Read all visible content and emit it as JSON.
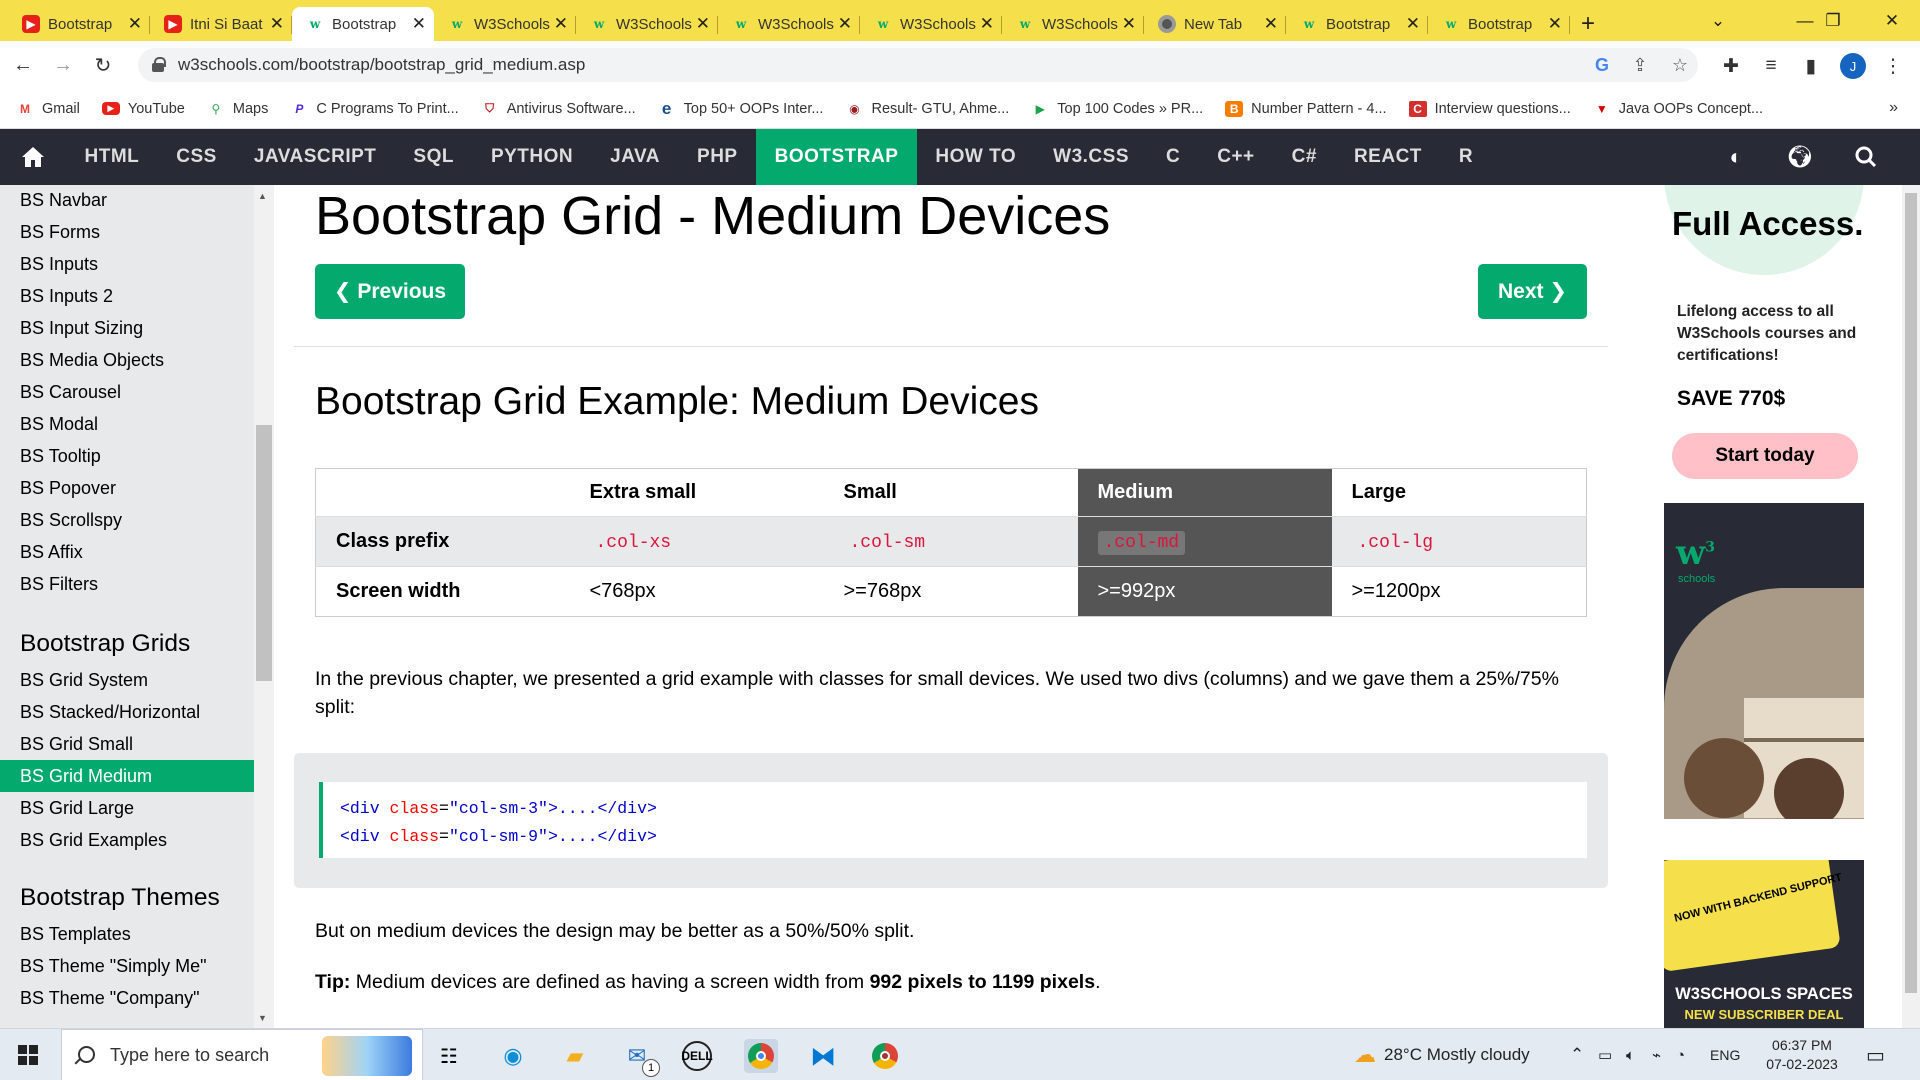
{
  "browser": {
    "tabs": [
      {
        "title": "Bootstrap",
        "icon": "youtube-icon"
      },
      {
        "title": "Itni Si Baat",
        "icon": "youtube-icon"
      },
      {
        "title": "Bootstrap",
        "icon": "w3schools-icon",
        "active": true
      },
      {
        "title": "W3Schools",
        "icon": "w3schools-icon"
      },
      {
        "title": "W3Schools",
        "icon": "w3schools-icon"
      },
      {
        "title": "W3Schools",
        "icon": "w3schools-icon"
      },
      {
        "title": "W3Schools",
        "icon": "w3schools-icon"
      },
      {
        "title": "W3Schools",
        "icon": "w3schools-icon"
      },
      {
        "title": "New Tab",
        "icon": "chrome-icon"
      },
      {
        "title": "Bootstrap",
        "icon": "w3schools-icon"
      },
      {
        "title": "Bootstrap",
        "icon": "w3schools-icon"
      }
    ],
    "url": "w3schools.com/bootstrap/bootstrap_grid_medium.asp",
    "avatar_letter": "J",
    "bookmarks": [
      {
        "label": "Gmail",
        "icon": "gmail-icon"
      },
      {
        "label": "YouTube",
        "icon": "youtube-icon"
      },
      {
        "label": "Maps",
        "icon": "maps-icon"
      },
      {
        "label": "C Programs To Print...",
        "icon": "p-icon"
      },
      {
        "label": "Antivirus Software...",
        "icon": "mcafee-icon"
      },
      {
        "label": "Top 50+ OOPs Inter...",
        "icon": "e-icon"
      },
      {
        "label": "Result- GTU, Ahme...",
        "icon": "gtu-icon"
      },
      {
        "label": "Top 100 Codes » PR...",
        "icon": "play-icon"
      },
      {
        "label": "Number Pattern - 4...",
        "icon": "blogger-icon"
      },
      {
        "label": "Interview questions...",
        "icon": "c-icon"
      },
      {
        "label": "Java OOPs Concept...",
        "icon": "javatpoint-icon"
      }
    ]
  },
  "topnav": {
    "items": [
      "HTML",
      "CSS",
      "JAVASCRIPT",
      "SQL",
      "PYTHON",
      "JAVA",
      "PHP",
      "BOOTSTRAP",
      "HOW TO",
      "W3.CSS",
      "C",
      "C++",
      "C#",
      "REACT",
      "R"
    ],
    "active": "BOOTSTRAP"
  },
  "sidebar": {
    "group1": [
      "BS Navbar",
      "BS Forms",
      "BS Inputs",
      "BS Inputs 2",
      "BS Input Sizing",
      "BS Media Objects",
      "BS Carousel",
      "BS Modal",
      "BS Tooltip",
      "BS Popover",
      "BS Scrollspy",
      "BS Affix",
      "BS Filters"
    ],
    "heading_grids": "Bootstrap Grids",
    "group2": [
      "BS Grid System",
      "BS Stacked/Horizontal",
      "BS Grid Small",
      "BS Grid Medium",
      "BS Grid Large",
      "BS Grid Examples"
    ],
    "active": "BS Grid Medium",
    "heading_themes": "Bootstrap Themes",
    "group3": [
      "BS Templates",
      "BS Theme \"Simply Me\"",
      "BS Theme \"Company\""
    ]
  },
  "main": {
    "title": "Bootstrap Grid - Medium Devices",
    "prev_label": "❮ Previous",
    "next_label": "Next ❯",
    "subtitle": "Bootstrap Grid Example: Medium Devices",
    "table": {
      "headers": [
        "",
        "Extra small",
        "Small",
        "Medium",
        "Large"
      ],
      "rows": [
        [
          "Class prefix",
          ".col-xs",
          ".col-sm",
          ".col-md",
          ".col-lg"
        ],
        [
          "Screen width",
          "<768px",
          ">=768px",
          ">=992px",
          ">=1200px"
        ]
      ]
    },
    "para1": "In the previous chapter, we presented a grid example with classes for small devices. We used two divs (columns) and we gave them a 25%/75% split:",
    "code": [
      {
        "tag_open": "<div",
        "attr": "class",
        "value": "\"col-sm-3\"",
        "rest": ">....</div>"
      },
      {
        "tag_open": "<div",
        "attr": "class",
        "value": "\"col-sm-9\"",
        "rest": ">....</div>"
      }
    ],
    "para2": "But on medium devices the design may be better as a 50%/50% split.",
    "tip_label": "Tip:",
    "tip_text": " Medium devices are defined as having a screen width from ",
    "tip_bold": "992 pixels to 1199 pixels",
    "tip_end": "."
  },
  "ads": {
    "title": "Full Access.",
    "text": "Lifelong access to all W3Schools courses and certifications!",
    "save": "SAVE 770$",
    "button": "Start today",
    "logo_text": "schools",
    "stamp": "NOW WITH BACKEND SUPPORT",
    "spaces": "W3SCHOOLS SPACES",
    "deal": "NEW SUBSCRIBER DEAL"
  },
  "taskbar": {
    "search_placeholder": "Type here to search",
    "weather": "28°C  Mostly cloudy",
    "lang": "ENG",
    "time": "06:37 PM",
    "date": "07-02-2023",
    "mail_badge": "1"
  }
}
